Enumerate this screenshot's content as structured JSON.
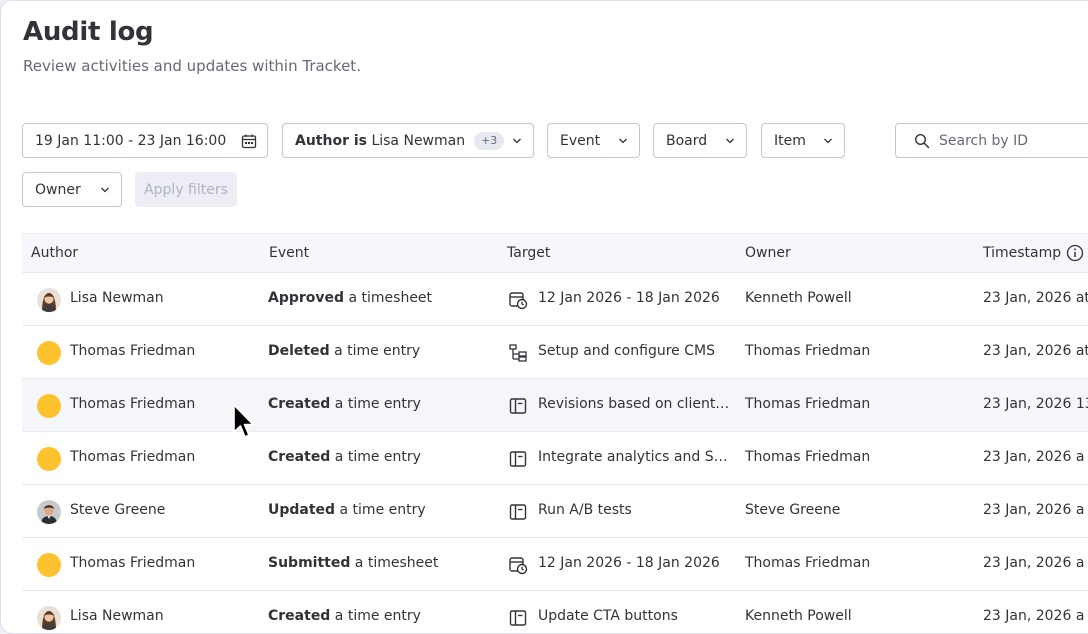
{
  "page": {
    "title": "Audit log",
    "subtitle": "Review activities and updates within Tracket."
  },
  "filters": {
    "date_range": "19 Jan 11:00 - 23 Jan 16:00",
    "author_prefix": "Author is",
    "author_value": "Lisa Newman",
    "author_extra": "+3",
    "event": "Event",
    "board": "Board",
    "item": "Item",
    "search_placeholder": "Search by ID",
    "owner": "Owner",
    "apply": "Apply filters"
  },
  "table": {
    "headers": {
      "author": "Author",
      "event": "Event",
      "target": "Target",
      "owner": "Owner",
      "timestamp": "Timestamp"
    },
    "rows": [
      {
        "author": "Lisa Newman",
        "avatar": "photo-woman",
        "action": "Approved",
        "object": " a timesheet",
        "target_icon": "timesheet-icon",
        "target": "12 Jan 2026 - 18 Jan 2026",
        "owner": "Kenneth Powell",
        "timestamp": "23 Jan, 2026 at"
      },
      {
        "author": "Thomas Friedman",
        "avatar": "yellow",
        "action": "Deleted",
        "object": " a time entry",
        "target_icon": "subitems-icon",
        "target": "Setup and configure CMS",
        "owner": "Thomas Friedman",
        "timestamp": "23 Jan, 2026 at"
      },
      {
        "author": "Thomas Friedman",
        "avatar": "yellow",
        "action": "Created",
        "object": " a time entry",
        "target_icon": "item-icon",
        "target": "Revisions based on client…",
        "owner": "Thomas Friedman",
        "timestamp": "23 Jan, 2026 13"
      },
      {
        "author": "Thomas Friedman",
        "avatar": "yellow",
        "action": "Created",
        "object": " a time entry",
        "target_icon": "item-icon",
        "target": "Integrate analytics and SE…",
        "owner": "Thomas Friedman",
        "timestamp": "23 Jan, 2026  a"
      },
      {
        "author": "Steve Greene",
        "avatar": "photo-man",
        "action": "Updated",
        "object": " a time entry",
        "target_icon": "item-icon",
        "target": "Run A/B tests",
        "owner": "Steve Greene",
        "timestamp": "23 Jan, 2026  a"
      },
      {
        "author": "Thomas Friedman",
        "avatar": "yellow",
        "action": "Submitted",
        "object": " a timesheet",
        "target_icon": "timesheet-icon",
        "target": "12 Jan 2026 - 18 Jan 2026",
        "owner": "Thomas Friedman",
        "timestamp": "23 Jan, 2026  a"
      },
      {
        "author": "Lisa Newman",
        "avatar": "photo-woman",
        "action": "Created",
        "object": " a time entry",
        "target_icon": "item-icon",
        "target": "Update CTA buttons",
        "owner": "Kenneth Powell",
        "timestamp": "23 Jan, 2026  a"
      }
    ]
  },
  "colors": {
    "avatar_yellow": "#fdc22e",
    "text_primary": "#323338",
    "text_secondary": "#676879",
    "border": "#c3c6d4"
  }
}
